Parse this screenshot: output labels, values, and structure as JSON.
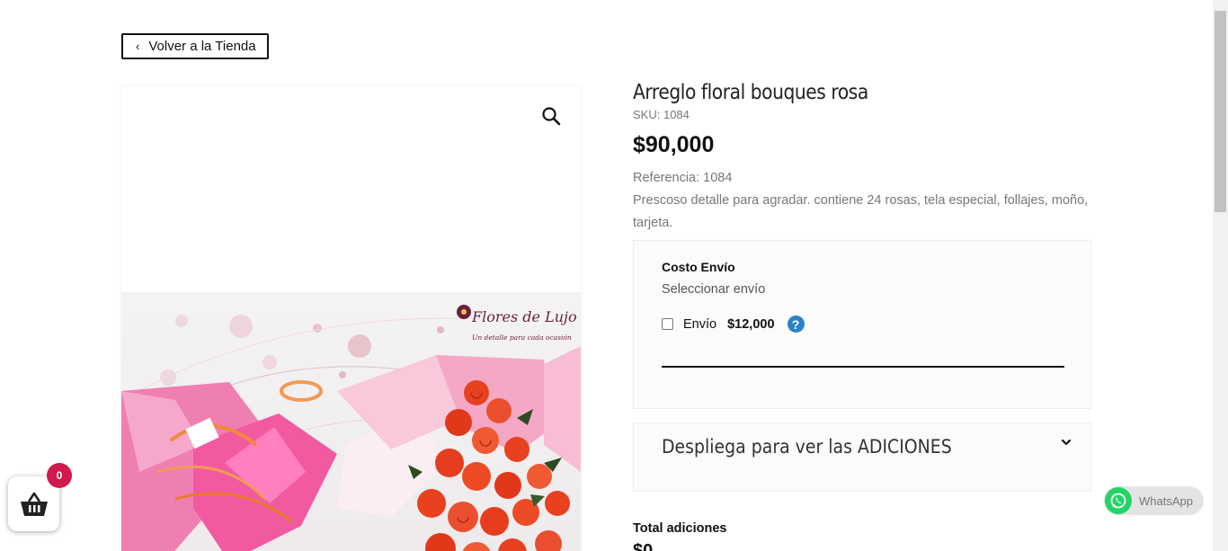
{
  "back_button": {
    "label": "Volver a la Tienda",
    "icon": "chevron-left-icon"
  },
  "gallery": {
    "zoom_icon": "magnifier-icon",
    "image_alt": "Arreglo floral bouques rosa",
    "logo_text": "Flores de Lujo",
    "logo_tagline": "Un detalle para cada ocasión",
    "colors": {
      "pink": "#f06aa8",
      "rose": "#e8411f",
      "leaf": "#2e4a22",
      "paper": "#f7d9e4"
    }
  },
  "product": {
    "title": "Arreglo floral bouques rosa",
    "sku_label": "SKU:",
    "sku": "1084",
    "price": "$90,000",
    "reference": "Referencia: 1084",
    "description": "Prescoso detalle para agradar. contiene 24 rosas, tela especial, follajes, moño, tarjeta."
  },
  "shipping": {
    "title": "Costo Envío",
    "subtitle": "Seleccionar envío",
    "option_label": "Envío",
    "option_price": "$12,000",
    "option_checked": false,
    "help_icon": "question-circle-icon",
    "help_color": "#2b82c9"
  },
  "addons": {
    "label": "Despliega para ver las ADICIONES",
    "icon": "chevron-down-icon"
  },
  "totals": {
    "label": "Total adiciones",
    "value": "$0"
  },
  "cart": {
    "icon": "basket-icon",
    "count": "0",
    "badge_color": "#d1194b"
  },
  "whatsapp": {
    "label": "WhatsApp",
    "icon": "whatsapp-icon",
    "color": "#25d366"
  }
}
